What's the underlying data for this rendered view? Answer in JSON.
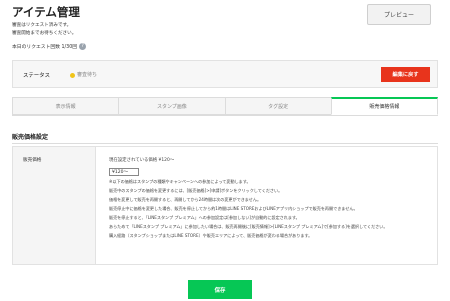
{
  "header": {
    "title": "アイテム管理",
    "preview_label": "プレビュー",
    "notice_lines": [
      "審査はリクエスト済みです。",
      "審査開始までお待ちください。"
    ],
    "quota_text": "本日のリクエスト回数 1/30回"
  },
  "status": {
    "label": "ステータス",
    "value": "審査待ち",
    "dot_color": "#f0c419",
    "resubmit_label": "編集に戻す"
  },
  "tabs": [
    {
      "label": "表示情報",
      "active": false
    },
    {
      "label": "スタンプ画像",
      "active": false
    },
    {
      "label": "タグ設定",
      "active": false
    },
    {
      "label": "販売価格情報",
      "active": true
    }
  ],
  "section": {
    "title": "販売価格設定",
    "row_label": "販売価格",
    "current_price": "現在設定されている価格 ¥120～",
    "select_value": "¥120～",
    "notes": [
      "※以下の価格はスタンプの種類やキャンペーンへの参加によって変動します。",
      "販売中のスタンプの価格を変更するには、[販売価格]>[申請]ボタンをクリックしてください。",
      "価格を変更して販売を再開すると、再開してから24時間は次の変更ができません。",
      "販売停止中に価格を変更した場合、販売を停止してから約1時間はLINE STOREおよびLINEアプリ内ショップで販売を再開できません。",
      "販売を停止すると、「LINEスタンプ プレミアム」への参加設定は[参加しない]が自動的に設定されます。",
      "あらためて「LINEスタンプ プレミアム」に参加したい場合は、販売再開後に[販売情報]>[LINEスタンプ プレミアム]で[参加する]を選択してください。",
      "購入経路（スタンプショップまたはLINE STORE）や販売エリアによって、販売価格が変わる場合があります。"
    ]
  },
  "footer": {
    "save_label": "保存"
  },
  "colors": {
    "accent_green": "#06c755",
    "danger_red": "#e8341c"
  }
}
